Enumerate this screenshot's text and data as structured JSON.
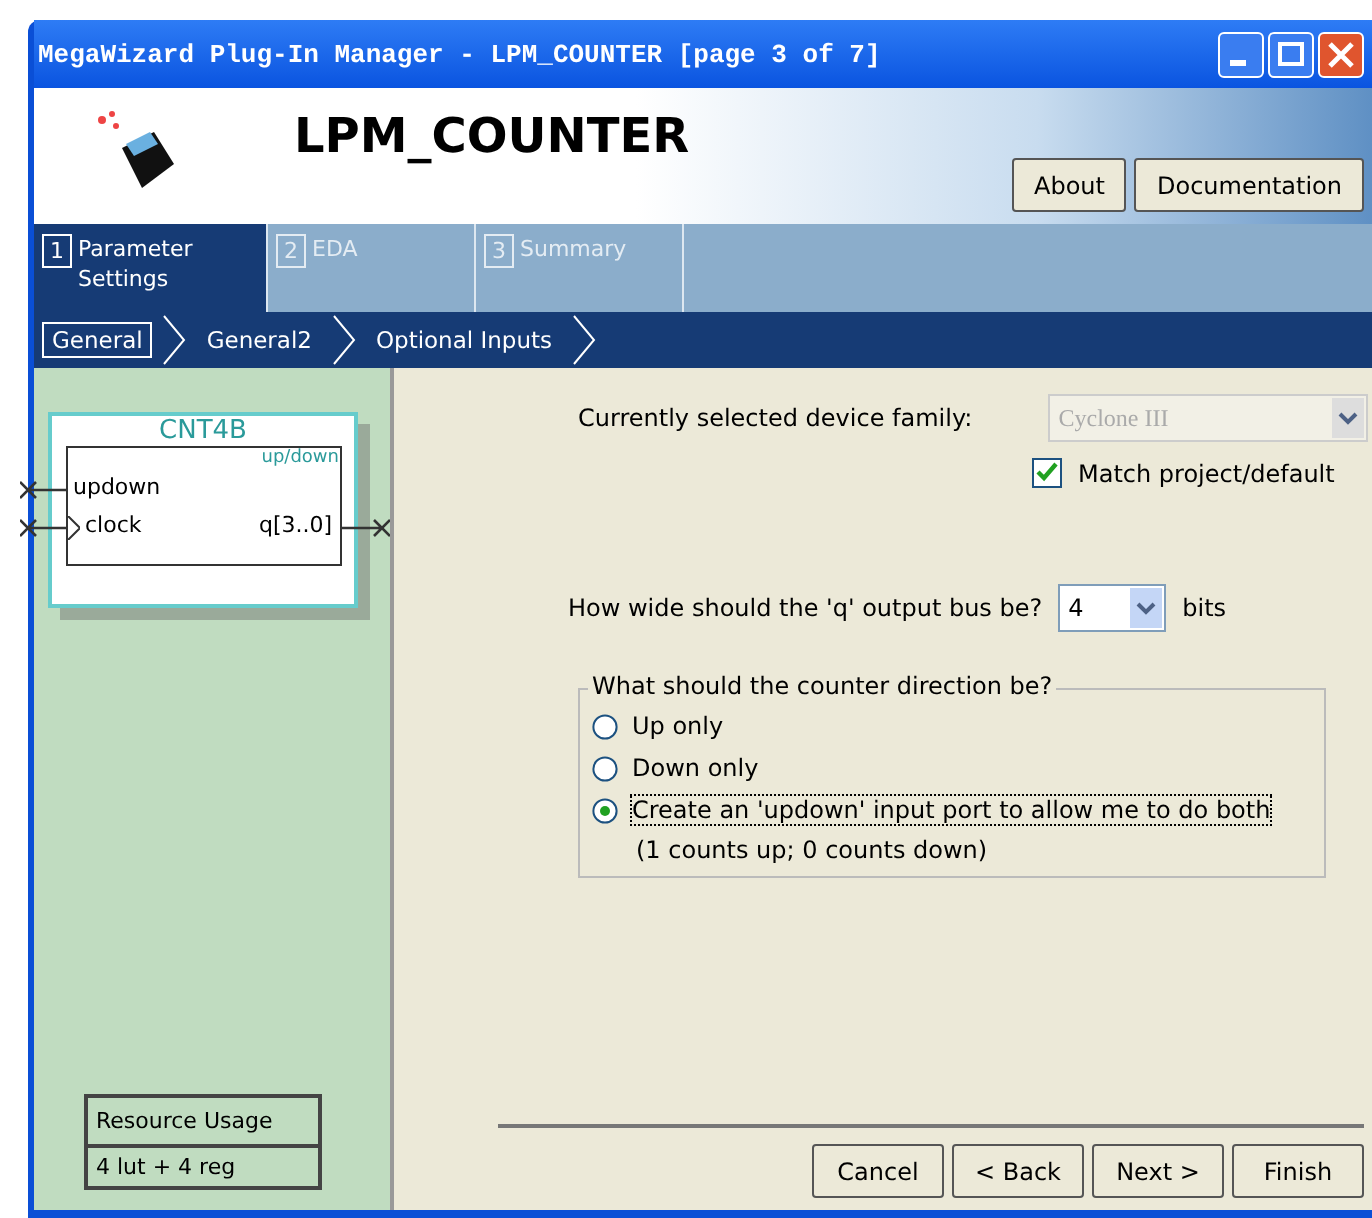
{
  "window": {
    "title": "MegaWizard Plug-In Manager - LPM_COUNTER [page 3 of 7]"
  },
  "header": {
    "title": "LPM_COUNTER",
    "buttons": [
      "About",
      "Documentation"
    ]
  },
  "tabs": [
    {
      "number": "1",
      "label": "Parameter Settings",
      "selected": true
    },
    {
      "number": "2",
      "label": "EDA",
      "selected": false
    },
    {
      "number": "3",
      "label": "Summary",
      "selected": false
    }
  ],
  "steps": [
    {
      "label": "General",
      "selected": true
    },
    {
      "label": "General2",
      "selected": false
    },
    {
      "label": "Optional Inputs",
      "selected": false
    }
  ],
  "diagram": {
    "name": "CNT4B",
    "mode": "up/down",
    "inputs": [
      {
        "label": "updown",
        "kind": "plain"
      },
      {
        "label": "clock",
        "kind": "clock"
      }
    ],
    "output": "q[3..0]"
  },
  "resource": {
    "title": "Resource Usage",
    "value": "4 lut + 4 reg"
  },
  "device": {
    "label": "Currently selected device family:",
    "value": "Cyclone III",
    "disabled": true
  },
  "match": {
    "label": "Match project/default",
    "checked": true
  },
  "width": {
    "label": "How wide should the 'q' output bus be?",
    "value": "4",
    "unit": "bits"
  },
  "direction": {
    "legend": "What should the counter direction be?",
    "options": [
      {
        "label": "Up only",
        "selected": false
      },
      {
        "label": "Down only",
        "selected": false
      },
      {
        "label": "Create an 'updown' input port to allow me to do both",
        "selected": true
      }
    ],
    "note": "(1 counts up; 0 counts down)"
  },
  "buttons": [
    "Cancel",
    "< Back",
    "Next >",
    "Finish"
  ]
}
